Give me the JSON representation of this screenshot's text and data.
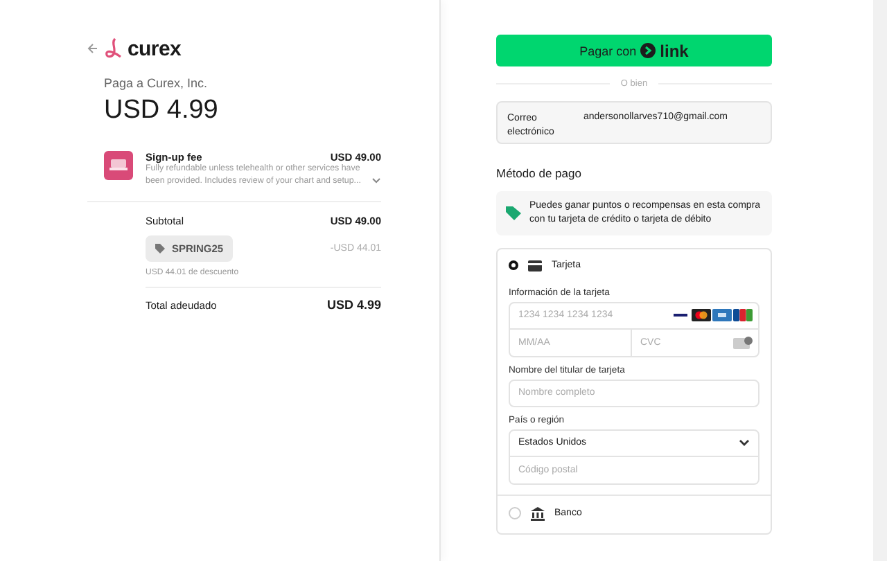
{
  "merchant": {
    "brand": "curex",
    "pay_to": "Paga a Curex, Inc.",
    "amount": "USD 4.99"
  },
  "line_item": {
    "name": "Sign-up fee",
    "price": "USD 49.00",
    "description": "Fully refundable unless telehealth or other services have been provided. Includes review of your chart and setup..."
  },
  "summary": {
    "subtotal_label": "Subtotal",
    "subtotal": "USD 49.00",
    "coupon": "SPRING25",
    "discount": "-USD 44.01",
    "discount_note": "USD 44.01 de descuento",
    "total_label": "Total adeudado",
    "total": "USD 4.99"
  },
  "link_button": {
    "label": "Pagar con",
    "brand": "link"
  },
  "divider_text": "O bien",
  "email": {
    "label": "Correo electrónico",
    "value": "andersonollarves710@gmail.com"
  },
  "payment_heading": "Método de pago",
  "rewards_note": "Puedes ganar puntos o recompensas en esta compra con tu tarjeta de crédito o tarjeta de débito",
  "methods": [
    {
      "kind": "card",
      "label": "Tarjeta",
      "selected": true
    },
    {
      "kind": "bank",
      "label": "Banco",
      "selected": false
    }
  ],
  "card_form": {
    "info_label": "Información de la tarjeta",
    "number_placeholder": "1234 1234 1234 1234",
    "expiry_placeholder": "MM/AA",
    "cvc_placeholder": "CVC",
    "name_label": "Nombre del titular de tarjeta",
    "name_placeholder": "Nombre completo",
    "country_label": "País o región",
    "country": "Estados Unidos",
    "postal_placeholder": "Código postal"
  }
}
